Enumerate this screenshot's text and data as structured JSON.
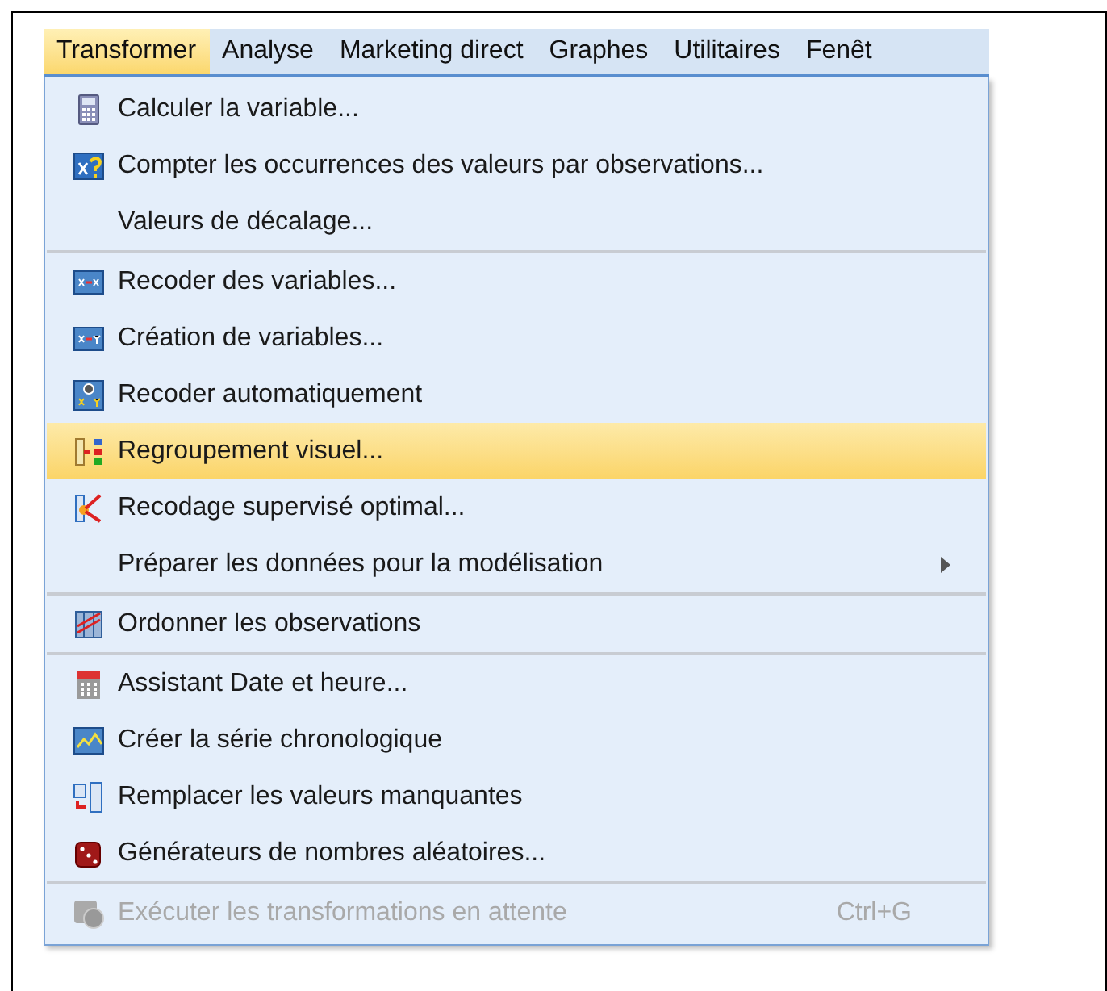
{
  "menubar": [
    {
      "label": "Transformer",
      "selected": true
    },
    {
      "label": "Analyse",
      "selected": false
    },
    {
      "label": "Marketing direct",
      "selected": false
    },
    {
      "label": "Graphes",
      "selected": false
    },
    {
      "label": "Utilitaires",
      "selected": false
    },
    {
      "label": "Fenêt",
      "selected": false
    }
  ],
  "menu": {
    "groups": [
      [
        {
          "kind": "command",
          "label": "Calculer la variable...",
          "selected": false,
          "disabled": false
        },
        {
          "kind": "command",
          "label": "Compter les occurrences des valeurs par observations...",
          "selected": false,
          "disabled": false
        },
        {
          "kind": "command",
          "label": "Valeurs de décalage...",
          "selected": false,
          "disabled": false
        }
      ],
      [
        {
          "kind": "command",
          "label": "Recoder des variables...",
          "selected": false,
          "disabled": false
        },
        {
          "kind": "command",
          "label": "Création de variables...",
          "selected": false,
          "disabled": false
        },
        {
          "kind": "command",
          "label": "Recoder automatiquement",
          "selected": false,
          "disabled": false
        },
        {
          "kind": "command",
          "label": "Regroupement visuel...",
          "selected": true,
          "disabled": false
        },
        {
          "kind": "command",
          "label": "Recodage supervisé optimal...",
          "selected": false,
          "disabled": false
        },
        {
          "kind": "submenu",
          "label": "Préparer les données pour la modélisation",
          "selected": false,
          "disabled": false
        }
      ],
      [
        {
          "kind": "command",
          "label": "Ordonner les observations",
          "selected": false,
          "disabled": false
        }
      ],
      [
        {
          "kind": "command",
          "label": "Assistant Date et heure...",
          "selected": false,
          "disabled": false
        },
        {
          "kind": "command",
          "label": "Créer la série chronologique",
          "selected": false,
          "disabled": false
        },
        {
          "kind": "command",
          "label": "Remplacer les valeurs manquantes",
          "selected": false,
          "disabled": false
        },
        {
          "kind": "command",
          "label": "Générateurs de nombres aléatoires...",
          "selected": false,
          "disabled": false
        }
      ],
      [
        {
          "kind": "command",
          "label": "Exécuter les transformations en attente",
          "selected": false,
          "disabled": true,
          "shortcut": "Ctrl+G"
        }
      ]
    ]
  }
}
